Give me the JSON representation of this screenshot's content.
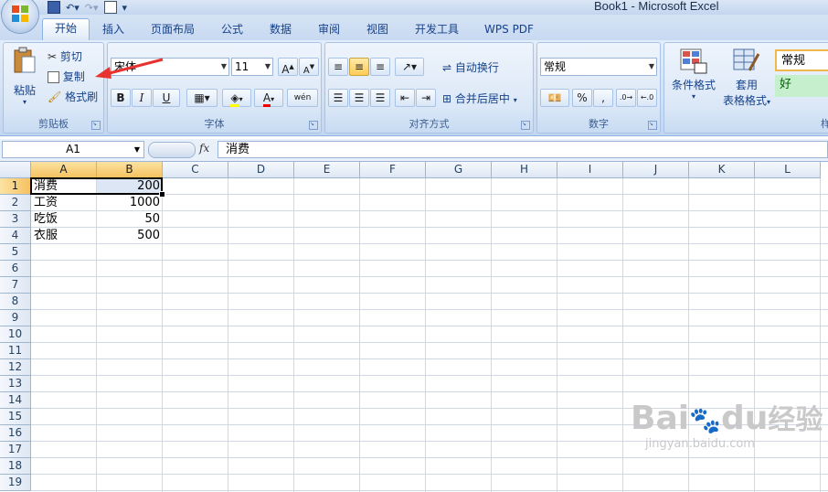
{
  "window": {
    "title": "Book1 - Microsoft Excel"
  },
  "tabs": [
    "开始",
    "插入",
    "页面布局",
    "公式",
    "数据",
    "审阅",
    "视图",
    "开发工具",
    "WPS PDF"
  ],
  "clipboard": {
    "paste": "粘贴",
    "cut": "剪切",
    "copy": "复制",
    "format_painter": "格式刷",
    "label": "剪贴板"
  },
  "font": {
    "name": "宋体",
    "size": "11",
    "bold": "B",
    "italic": "I",
    "underline": "U",
    "font_color_glyph": "A",
    "phonetic": "wén",
    "label": "字体"
  },
  "alignment": {
    "wrap_text": "自动换行",
    "merge_center": "合并后居中",
    "label": "对齐方式"
  },
  "number": {
    "format": "常规",
    "percent": "%",
    "comma": ",",
    "label": "数字"
  },
  "styles": {
    "conditional_formatting": "条件格式",
    "table_format_line1": "套用",
    "table_format_line2": "表格格式",
    "normal": "常规",
    "good": "好",
    "label": "样"
  },
  "formula_bar": {
    "name_box": "A1",
    "fx": "fx",
    "value": "消费"
  },
  "sheet": {
    "columns": [
      "A",
      "B",
      "C",
      "D",
      "E",
      "F",
      "G",
      "H",
      "I",
      "J",
      "K",
      "L"
    ],
    "rows": [
      "1",
      "2",
      "3",
      "4",
      "5",
      "6",
      "7",
      "8",
      "9",
      "10",
      "11",
      "12",
      "13",
      "14",
      "15",
      "16",
      "17",
      "18",
      "19"
    ],
    "data": [
      [
        "消费",
        "200"
      ],
      [
        "工资",
        "1000"
      ],
      [
        "吃饭",
        "50"
      ],
      [
        "衣服",
        "500"
      ]
    ],
    "selected_cell": "A1"
  },
  "watermark": {
    "brand": "Bai",
    "brand2": "du",
    "jy": "经验",
    "url": "jingyan.baidu.com"
  },
  "colors": {
    "accent": "#15428b",
    "selection": "#f5c260",
    "arrow": "#e8322f"
  }
}
